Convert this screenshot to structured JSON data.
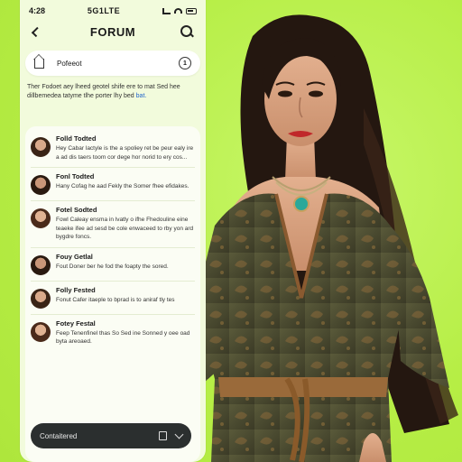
{
  "status_bar": {
    "time": "4:28",
    "center": "5G1LTE"
  },
  "header": {
    "title": "FORUM",
    "back_icon": "back-arrow-icon",
    "search_icon": "search-icon"
  },
  "post_bar": {
    "label": "Pofeeot",
    "home_icon": "home-icon",
    "info_icon": "info-icon",
    "info_glyph": "1"
  },
  "intro": {
    "text": "Ther Fodoet aey lheed geotel shife ere to mat Sed hee dillbemedea tatyme tlhe",
    "text_end": "porter lhy bed",
    "link": "bat."
  },
  "threads": [
    {
      "title": "Folld Todted",
      "text": "Hey Cabar lactyle is the a spoliey ret be peur ealy ire a ad dis taers toom cor dege hor norid to ery cos..."
    },
    {
      "title": "Fonl Todted",
      "text": "Hany Cofag he aad Fekly the Somer fhee efidakes."
    },
    {
      "title": "Fotel Sodted",
      "text": "Fowl Caleay ensma in lvatly o ifhe Fhedouline eine teaeke ifee ad sesd be cole enwaceed to rby yon ard bygdre foncs."
    },
    {
      "title": "Fouy Getlal",
      "text": "Fout Doner ber he fod the foapty the sored."
    },
    {
      "title": "Folly Fested",
      "text": "Fonut Cafer itaeple to bprad is to aniraf tly tes"
    },
    {
      "title": "Fotey Festal",
      "text": "Feep Tenenfinel thas So Sed ine Sonned y oee oad byta areoaed."
    }
  ],
  "bottom_bar": {
    "label": "Contaitered",
    "copy_icon": "copy-icon",
    "chevron_icon": "chevron-down-icon"
  },
  "colors": {
    "background": "#b8f04a",
    "panel": "#f2fbdc",
    "bottom_bar": "#2b2f2f",
    "link": "#2266cc"
  }
}
